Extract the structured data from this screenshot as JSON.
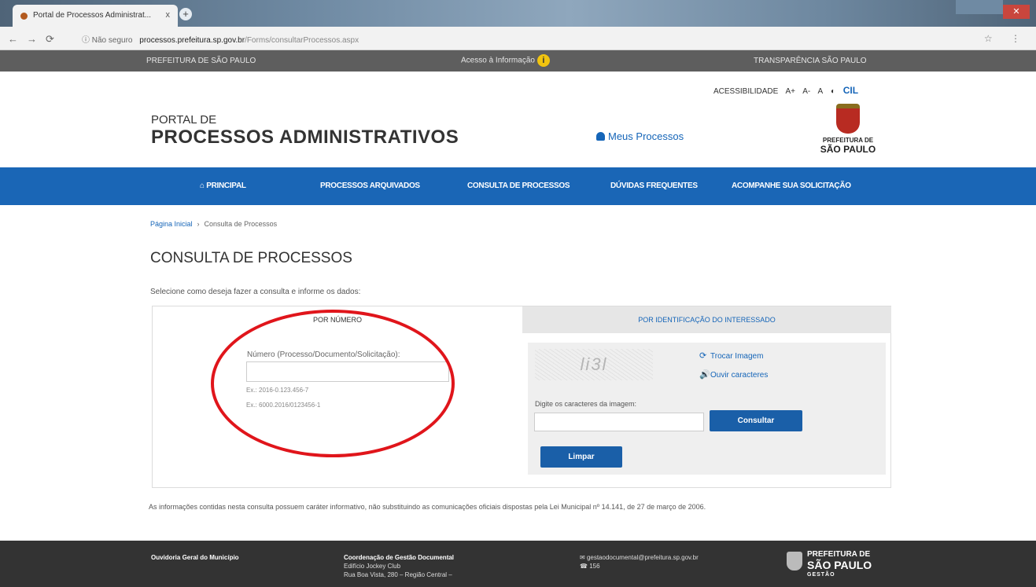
{
  "browser": {
    "tab_title": "Portal de Processos Administrat...",
    "tab_close": "x",
    "new_tab": "+",
    "security_label": "ⓘ Não seguro",
    "url_host": "processos.prefeitura.sp.gov.br",
    "url_path": "/Forms/consultarProcessos.aspx"
  },
  "gov_bar": {
    "left": "PREFEITURA DE SÃO PAULO",
    "center": "Acesso à Informação",
    "right": "TRANSPARÊNCIA SÃO PAULO"
  },
  "accessibility": {
    "label": "ACESSIBILIDADE",
    "font_increase": "A+",
    "font_decrease": "A-",
    "font_normal": "A",
    "contrast": "◐",
    "cil": "CIL"
  },
  "header": {
    "portal_line1": "PORTAL DE",
    "portal_line2": "PROCESSOS ADMINISTRATIVOS",
    "meus_processos": "Meus Processos",
    "brand_line1": "PREFEITURA DE",
    "brand_line2": "SÃO PAULO"
  },
  "nav": {
    "items": [
      {
        "label": "⌂ PRINCIPAL"
      },
      {
        "label": "PROCESSOS ARQUIVADOS"
      },
      {
        "label": "CONSULTA DE PROCESSOS"
      },
      {
        "label": "DÚVIDAS FREQUENTES"
      },
      {
        "label": "ACOMPANHE SUA SOLICITAÇÃO"
      }
    ]
  },
  "breadcrumb": {
    "home": "Página Inicial",
    "separator": "›",
    "current": "Consulta de Processos"
  },
  "page": {
    "title": "CONSULTA DE PROCESSOS",
    "intro": "Selecione como deseja fazer a consulta e informe os dados:"
  },
  "tabs": {
    "por_numero": "POR NÚMERO",
    "por_identificacao": "POR IDENTIFICAÇÃO DO INTERESSADO"
  },
  "form": {
    "numero_label": "Número (Processo/Documento/Solicitação):",
    "numero_value": "",
    "example1": "Ex.: 2016-0.123.456-7",
    "example2": "Ex.: 6000.2016/0123456-1",
    "captcha_text": "li3l",
    "trocar_imagem": "Trocar Imagem",
    "ouvir_caracteres": "Ouvir caracteres",
    "captcha_label": "Digite os caracteres da imagem:",
    "captcha_value": "",
    "consultar": "Consultar",
    "limpar": "Limpar"
  },
  "disclaimer": "As informações contidas nesta consulta possuem caráter informativo, não substituindo as comunicações oficiais dispostas pela Lei Municipal nº 14.141, de 27 de março de 2006.",
  "footer": {
    "ouvidoria": "Ouvidoria Geral do Município",
    "coord_title": "Coordenação de Gestão Documental",
    "coord_line1": "Edifício Jockey Club",
    "coord_line2": "Rua Boa Vista, 280 – Região Central –",
    "email": "gestaodocumental@prefeitura.sp.gov.br",
    "phone": "156",
    "brand_line1": "PREFEITURA DE",
    "brand_line2": "SÃO PAULO",
    "brand_line3": "GESTÃO"
  },
  "colors": {
    "nav_blue": "#1a66b6",
    "button_blue": "#1a5fa8",
    "highlight_red": "#e0151b"
  }
}
